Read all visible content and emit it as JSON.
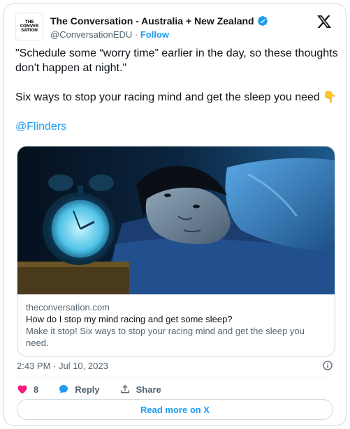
{
  "author": {
    "display_name": "The Conversation - Australia + New Zealand",
    "handle": "@ConversationEDU",
    "separator": " · ",
    "follow_label": "Follow",
    "avatar_lines": [
      "THE",
      "CONVER",
      "SATION"
    ]
  },
  "tweet": {
    "line1": "\"Schedule some “worry time” earlier in the day, so these thoughts don't happen at night.\"",
    "line2": "Six ways to stop your racing mind and get the sleep you need 👇",
    "mention": "@Flinders"
  },
  "link_card": {
    "domain": "theconversation.com",
    "title": "How do I stop my mind racing and get some sleep?",
    "description": "Make it stop! Six ways to stop your racing mind and get the sleep you need."
  },
  "timestamp": "2:43 PM · Jul 10, 2023",
  "actions": {
    "like_count": "8",
    "reply_label": "Reply",
    "share_label": "Share"
  },
  "read_more_label": "Read more on X",
  "colors": {
    "accent": "#1d9bf0",
    "like": "#f91880",
    "text": "#0f1419",
    "muted": "#536471"
  }
}
